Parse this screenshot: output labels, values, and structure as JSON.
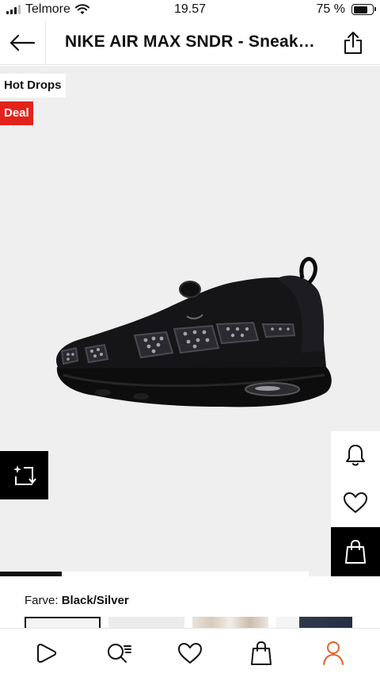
{
  "status_bar": {
    "carrier": "Telmore",
    "time": "19.57",
    "battery_percent": "75 %",
    "battery_level": 0.75
  },
  "header": {
    "title": "NIKE AIR MAX SNDR - Sneakers lave",
    "back_icon": "arrow-left-icon",
    "share_icon": "share-icon"
  },
  "product": {
    "tags": [
      "Hot Drops",
      "Deal"
    ],
    "image_alt": "Black Nike Air Max SNDR sneaker",
    "image_progress": 0.2,
    "color_label": "Farve:",
    "color_value": "Black/Silver",
    "swatch_count": 4,
    "selected_swatch": 0
  },
  "side_actions": [
    "bell-icon",
    "heart-icon",
    "bag-icon"
  ],
  "bottom_nav": [
    {
      "name": "play-icon"
    },
    {
      "name": "search-list-icon"
    },
    {
      "name": "heart-icon"
    },
    {
      "name": "bag-icon"
    },
    {
      "name": "profile-icon",
      "active": true
    }
  ],
  "colors": {
    "accent": "#e2231a",
    "profile_active": "#e0622a",
    "deal_bg": "#e2231a"
  }
}
